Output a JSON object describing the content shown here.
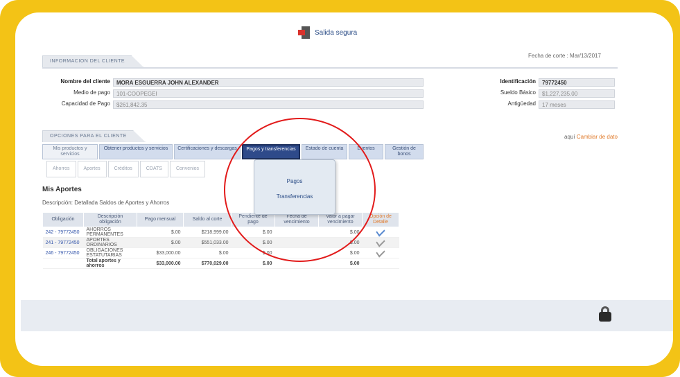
{
  "logout": {
    "label": "Salida segura"
  },
  "header": {
    "cut_date": "Fecha de corte : Mar/13/2017"
  },
  "client_section": {
    "tab_label": "INFORMACION DEL CLIENTE",
    "name_label": "Nombre del cliente",
    "name_value": "MORA ESGUERRA JOHN ALEXANDER",
    "payment_method_label": "Medio de pago",
    "payment_method_value": "101-COOPEGEI",
    "payment_capacity_label": "Capacidad de Pago",
    "payment_capacity_value": "$261,842.35",
    "id_label": "Identificación",
    "id_value": "79772450",
    "salary_label": "Sueldo Básico",
    "salary_value": "$1,227,235.00",
    "seniority_label": "Antigüedad",
    "seniority_value": "17 meses"
  },
  "options_section": {
    "tab_label": "OPCIONES PARA EL CLIENTE",
    "change_data_prefix": "aquí",
    "change_data_link": "Cambiar de dato"
  },
  "tabs": [
    {
      "label": "Mis productos y servicios"
    },
    {
      "label": "Obtener productos y servicios"
    },
    {
      "label": "Certificaciones y descargas"
    },
    {
      "label": "Pagos y transferencias"
    },
    {
      "label": "Estado de cuenta"
    },
    {
      "label": "Eventos"
    },
    {
      "label": "Gestión de bonos"
    }
  ],
  "subtabs": [
    {
      "label": "Ahorros"
    },
    {
      "label": "Aportes"
    },
    {
      "label": "Créditos"
    },
    {
      "label": "CDATS"
    },
    {
      "label": "Convenios"
    }
  ],
  "dropdown": {
    "items": [
      "Pagos",
      "Transferencias"
    ]
  },
  "contributions": {
    "title": "Mis Aportes",
    "description": "Descripción: Detallada Saldos de Aportes y Ahorros",
    "headers": [
      "Obligación",
      "Descripción obligación",
      "Pago mensual",
      "Saldo al corte",
      "Pendiente de pago",
      "Fecha de vencimiento",
      "Valor a pagar vencimiento",
      "Opción de Detalle"
    ],
    "rows": [
      {
        "obligation": "242 - 79772450",
        "description": "AHORROS PERMANENTES",
        "monthly": "$.00",
        "balance": "$218,999.00",
        "pending": "$.00",
        "due_date": "",
        "due_value": "$.00"
      },
      {
        "obligation": "241 - 79772450",
        "description": "APORTES ORDINARIOS",
        "monthly": "$.00",
        "balance": "$551,033.00",
        "pending": "$.00",
        "due_date": "",
        "due_value": "$.00"
      },
      {
        "obligation": "246 - 79772450",
        "description": "OBLIGACIONES ESTATUTARIAS",
        "monthly": "$33,000.00",
        "balance": "$.00",
        "pending": "$.00",
        "due_date": "",
        "due_value": "$.00"
      }
    ],
    "total": {
      "label": "Total aportes y ahorros",
      "monthly": "$33,000.00",
      "balance": "$770,029.00",
      "pending": "$.00",
      "due_value": "$.00"
    }
  },
  "colors": {
    "frame": "#f3c316",
    "highlight_circle": "#e21b1b",
    "active_tab": "#2e4a8a"
  }
}
